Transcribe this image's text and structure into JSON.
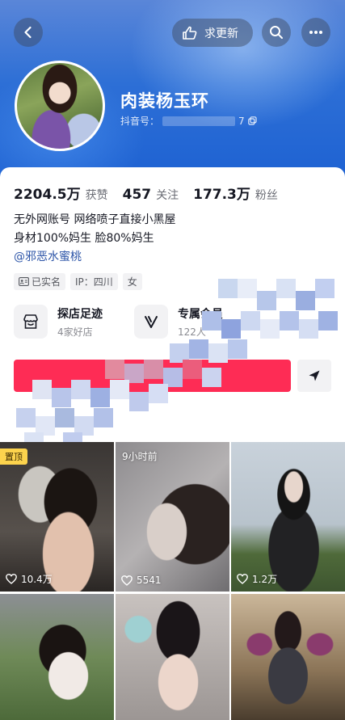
{
  "header": {
    "update_label": "求更新",
    "nickname": "肉装杨玉环",
    "douyin_id_label": "抖音号：",
    "douyin_id_tail": "7"
  },
  "stats": [
    {
      "value": "2204.5万",
      "label": "获赞"
    },
    {
      "value": "457",
      "label": "关注"
    },
    {
      "value": "177.3万",
      "label": "粉丝"
    }
  ],
  "bio": {
    "line1": "无外网账号 网络喷子直接小黑屋",
    "line2": "身材100%妈生 脸80%妈生",
    "link": "@邪恶水蜜桃"
  },
  "tags": [
    {
      "label": "已实名",
      "icon": "id-card-icon"
    },
    {
      "label": "IP：四川"
    },
    {
      "label": "女"
    }
  ],
  "services": [
    {
      "title": "探店足迹",
      "sub": "4家好店",
      "icon": "store-icon"
    },
    {
      "title": "专属会员",
      "sub": "122人",
      "icon": "v-badge-icon"
    }
  ],
  "videos": [
    {
      "likes": "10.4万",
      "badge": "置顶"
    },
    {
      "likes": "5541",
      "time": "9小时前"
    },
    {
      "likes": "1.2万"
    },
    {},
    {},
    {}
  ],
  "colors": {
    "accent": "#fe2c55",
    "link": "#2d55a8",
    "banner": "#2d6fd6",
    "pin_badge": "#fcd34d"
  }
}
